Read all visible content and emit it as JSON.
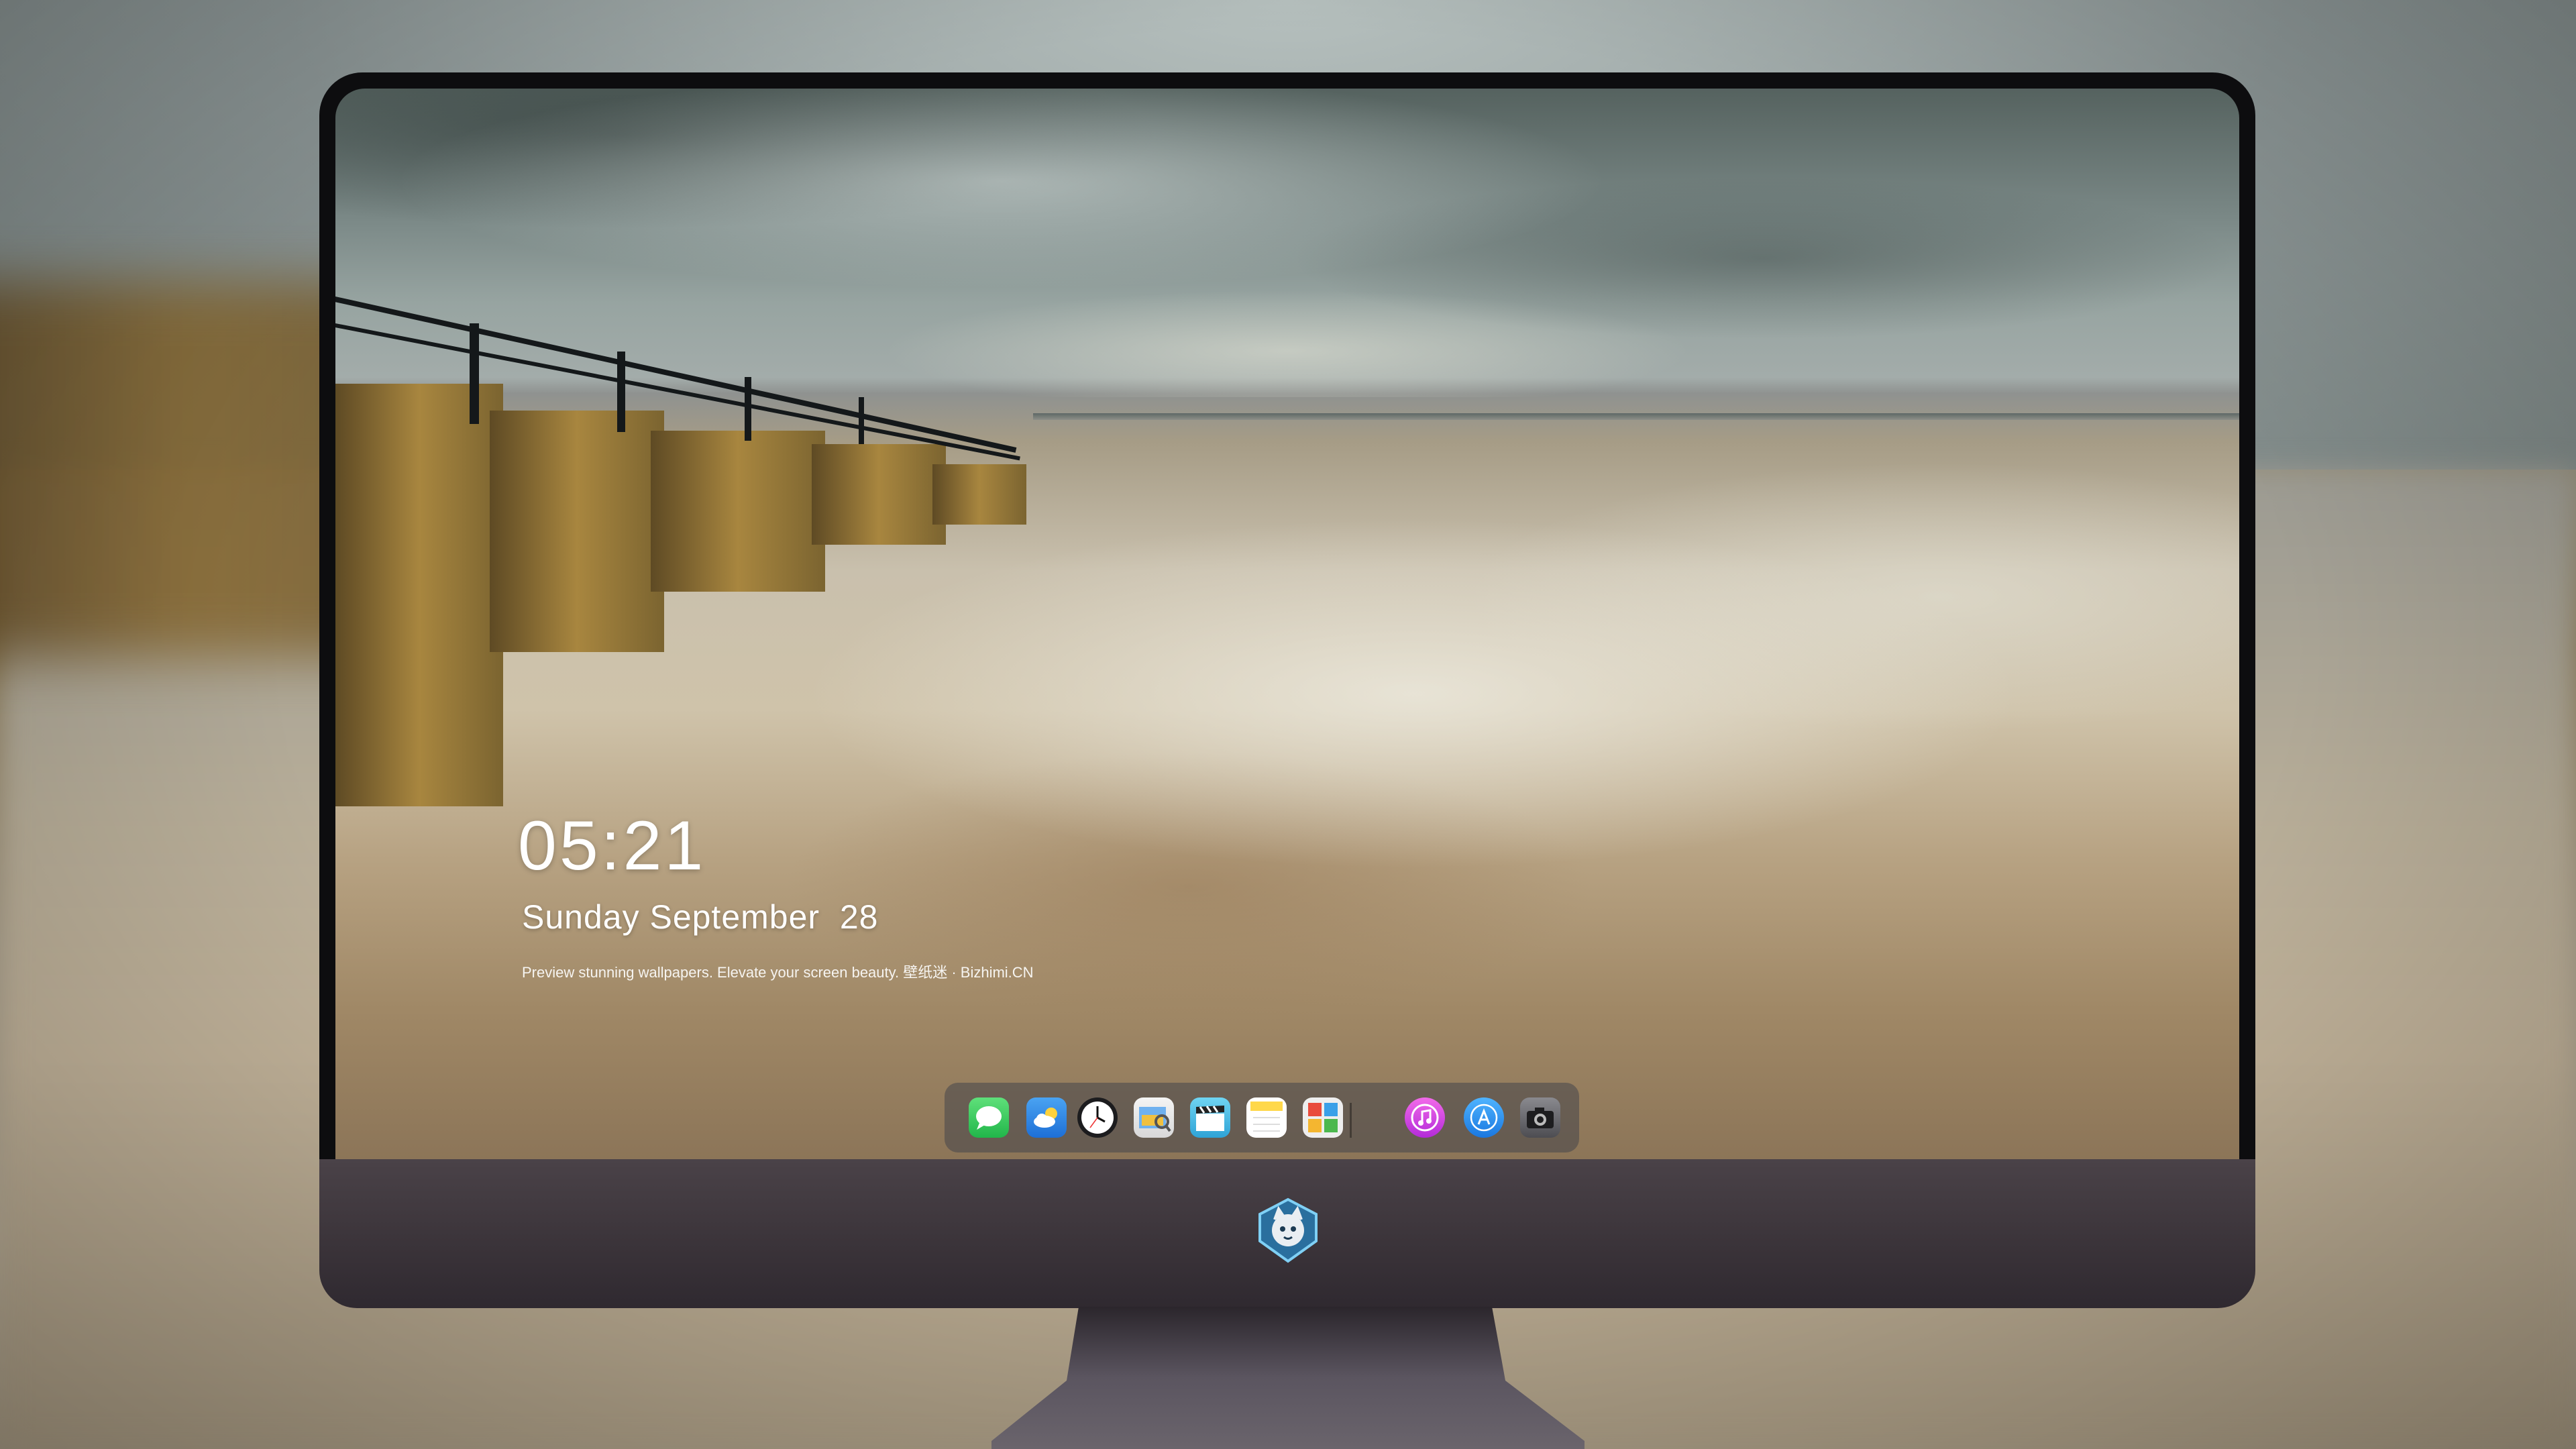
{
  "lockscreen": {
    "time": "05:21",
    "date": "Sunday September  28",
    "tagline": "Preview stunning wallpapers. Elevate your screen beauty. 壁纸迷 · Bizhimi.CN"
  },
  "dock": {
    "apps": [
      {
        "name": "Messages",
        "icon": "messages-icon",
        "color": "#34c759"
      },
      {
        "name": "Weather",
        "icon": "weather-icon",
        "color": "#2f7fe0"
      },
      {
        "name": "Clock",
        "icon": "clock-icon",
        "color": "#ffffff"
      },
      {
        "name": "Preview",
        "icon": "preview-icon",
        "color": "#e9b53a"
      },
      {
        "name": "Clips",
        "icon": "clapperboard-icon",
        "color": "#4fc3e8"
      },
      {
        "name": "Notes",
        "icon": "notes-icon",
        "color": "#ffd84a"
      },
      {
        "name": "Photo Booth",
        "icon": "photo-booth-icon",
        "color": "#ea5a4a"
      },
      {
        "name": "iTunes",
        "icon": "music-icon",
        "color": "#d63ad8"
      },
      {
        "name": "App Store",
        "icon": "app-store-icon",
        "color": "#1b8ff0"
      },
      {
        "name": "Camera",
        "icon": "camera-icon",
        "color": "#5a5a5e"
      }
    ]
  },
  "monitor": {
    "logo_icon": "cat-shield-logo-icon"
  }
}
